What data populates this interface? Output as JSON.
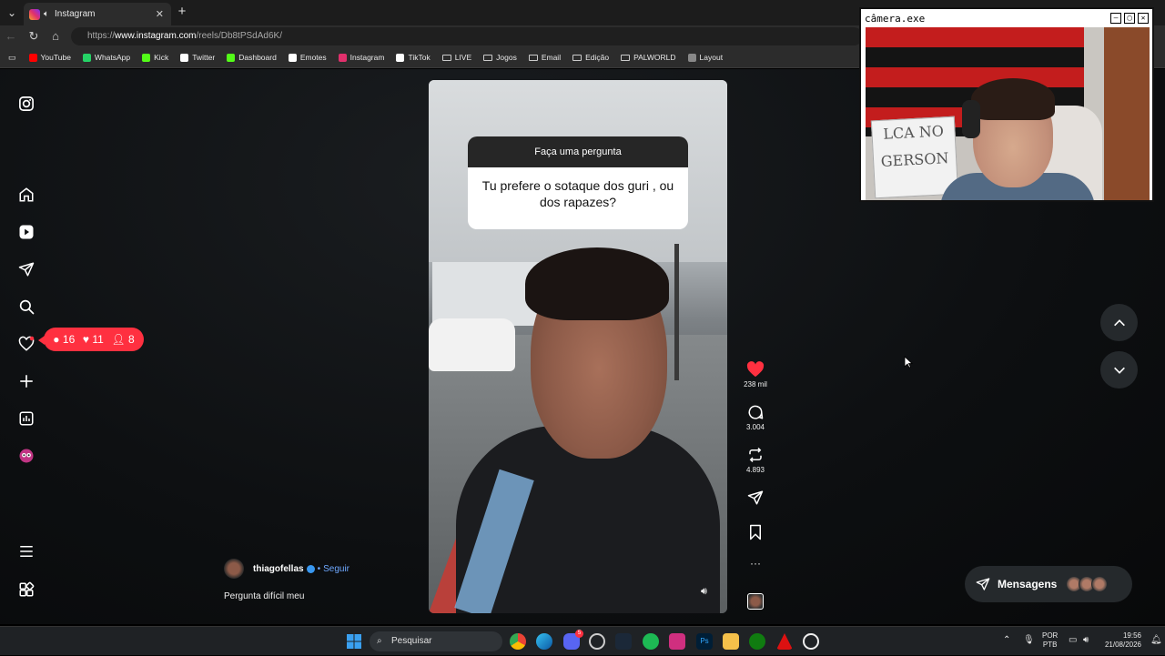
{
  "browser": {
    "tab_title": "Instagram",
    "new_tab_symbol": "+",
    "url_prefix": "https://",
    "url_host": "www.instagram.com",
    "url_path": "/reels/Db8tPSdAd6K/",
    "bookmarks": [
      {
        "label": "YouTube",
        "icon": "youtube-icon",
        "color": "#ff0000"
      },
      {
        "label": "WhatsApp",
        "icon": "whatsapp-icon",
        "color": "#25d366"
      },
      {
        "label": "Kick",
        "icon": "kick-icon",
        "color": "#53fc18"
      },
      {
        "label": "Twitter",
        "icon": "x-icon",
        "color": "#ffffff"
      },
      {
        "label": "Dashboard",
        "icon": "kick-icon",
        "color": "#53fc18"
      },
      {
        "label": "Emotes",
        "icon": "7tv-icon",
        "color": "#ffffff"
      },
      {
        "label": "Instagram",
        "icon": "instagram-icon",
        "color": "#e1306c"
      },
      {
        "label": "TikTok",
        "icon": "tiktok-icon",
        "color": "#ffffff"
      },
      {
        "label": "LIVE",
        "icon": "folder-icon",
        "color": ""
      },
      {
        "label": "Jogos",
        "icon": "folder-icon",
        "color": ""
      },
      {
        "label": "Email",
        "icon": "folder-icon",
        "color": ""
      },
      {
        "label": "Edição",
        "icon": "folder-icon",
        "color": ""
      },
      {
        "label": "PALWORLD",
        "icon": "folder-icon",
        "color": ""
      },
      {
        "label": "Layout",
        "icon": "layout-icon",
        "color": ""
      }
    ]
  },
  "notifications": {
    "comments": "16",
    "likes": "11",
    "follows": "8"
  },
  "reel": {
    "question_header": "Faça uma pergunta",
    "question_text": "Tu prefere o sotaque dos guri , ou dos rapazes?",
    "author": "thiagofellas",
    "follow_label": "Seguir",
    "separator": "•",
    "caption": "Pergunta difícil meu",
    "likes": "238 mil",
    "comments": "3.004",
    "reposts": "4.893",
    "more": "···"
  },
  "messages_label": "Mensagens",
  "camera": {
    "title": "câmera.exe",
    "sign_text_1": "LCA NO",
    "sign_text_2": "GERSON"
  },
  "taskbar": {
    "search_placeholder": "Pesquisar",
    "lang_1": "POR",
    "lang_2": "PTB",
    "time": "19:56",
    "date": "21/08/2026",
    "discord_badge": "5"
  },
  "colors": {
    "accent": "#ff3040",
    "like_red": "#ff3040",
    "link_blue": "#6ea8ff"
  }
}
